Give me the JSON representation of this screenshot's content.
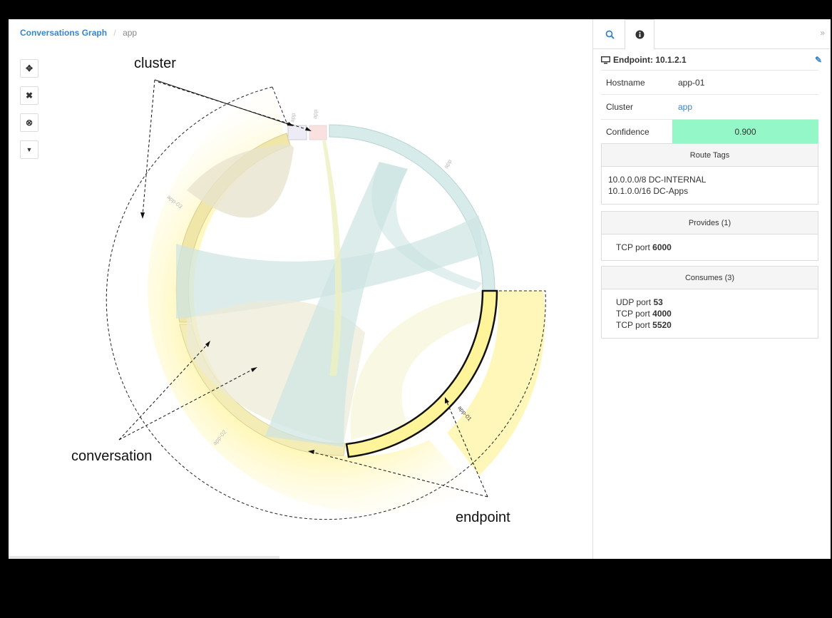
{
  "breadcrumb": {
    "root": "Conversations Graph",
    "separator": "/",
    "current": "app"
  },
  "toolbar": {
    "buttons": [
      {
        "name": "move-icon",
        "glyph": "✥"
      },
      {
        "name": "close-icon",
        "glyph": "✖"
      },
      {
        "name": "reset-icon",
        "glyph": "⊗"
      },
      {
        "name": "filter-icon",
        "glyph": "▼"
      }
    ]
  },
  "graph": {
    "segment_labels": {
      "top_small_1": "app",
      "top_small_2": "app",
      "right_cluster": "app",
      "left_cluster": "app-03",
      "bottom_left": "app-02",
      "selected": "app-01"
    },
    "annotations": {
      "cluster": "cluster",
      "conversation": "conversation",
      "endpoint": "endpoint"
    },
    "colors": {
      "teal": "#cfe8e6",
      "yellow": "#fff7b0",
      "beige": "#e8e4c4",
      "selected_stroke": "#111111"
    }
  },
  "panel": {
    "tabs": {
      "search_icon": "search-icon",
      "info_icon": "info-icon",
      "collapse": "»"
    },
    "endpoint_title": "Endpoint: 10.1.2.1",
    "fields": [
      {
        "key": "Hostname",
        "value": "app-01"
      },
      {
        "key": "Cluster",
        "value": "app"
      },
      {
        "key": "Confidence",
        "value": "0.900"
      }
    ],
    "route_tags": {
      "title": "Route Tags",
      "lines": [
        "10.0.0.0/8 DC-INTERNAL",
        "10.1.0.0/16 DC-Apps"
      ]
    },
    "provides": {
      "title": "Provides (1)",
      "items": [
        {
          "proto": "TCP port",
          "port": "6000"
        }
      ]
    },
    "consumes": {
      "title": "Consumes (3)",
      "items": [
        {
          "proto": "UDP port",
          "port": "53"
        },
        {
          "proto": "TCP port",
          "port": "4000"
        },
        {
          "proto": "TCP port",
          "port": "5520"
        }
      ]
    }
  }
}
